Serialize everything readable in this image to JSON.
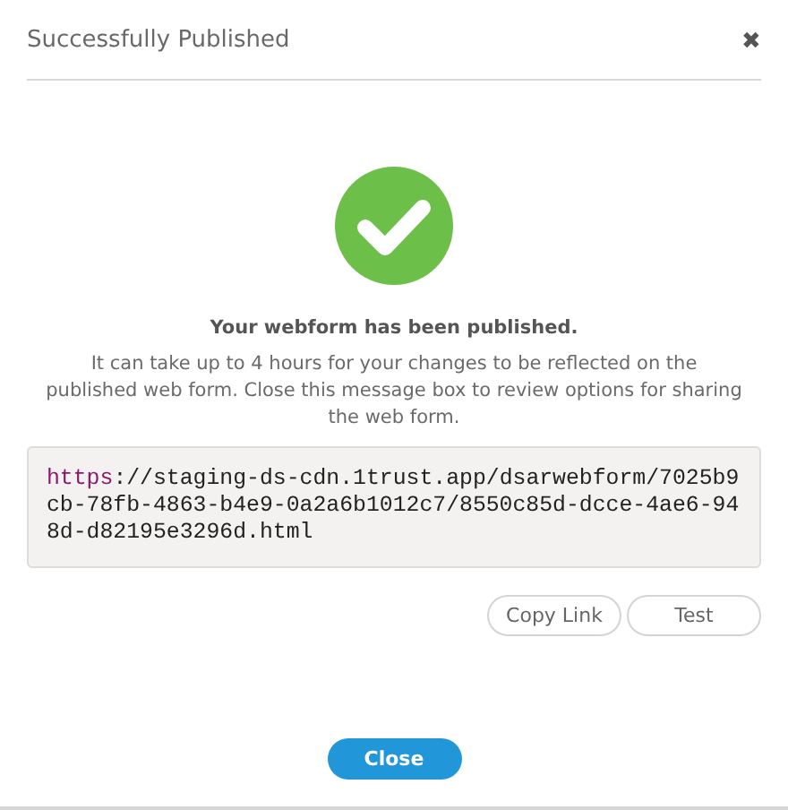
{
  "dialog": {
    "title": "Successfully Published",
    "close_icon": "✖"
  },
  "message": {
    "heading": "Your webform has been published.",
    "body": "It can take up to 4 hours for your changes to be reflected on the published web form. Close this message box to review options for sharing the web form."
  },
  "link": {
    "scheme": "https",
    "rest": "://staging-ds-cdn.1trust.app/dsarwebform/7025b9cb-78fb-4863-b4e9-0a2a6b1012c7/8550c85d-dcce-4ae6-948d-d82195e3296d.html"
  },
  "actions": [
    "Copy Link",
    "Test"
  ],
  "footer": {
    "button": "Close"
  }
}
